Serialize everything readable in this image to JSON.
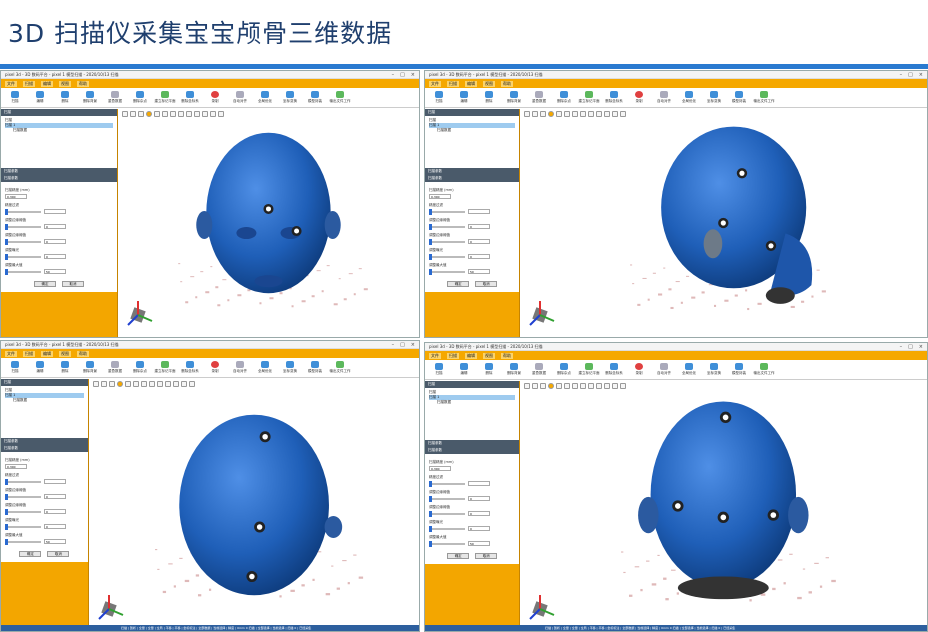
{
  "slide": {
    "title": "3D 扫描仪采集宝宝颅骨三维数据"
  },
  "app": {
    "window_title": "pixel 3d - 3D 数码平台 - pixel 1 模型扫描 - 2020/10/13 扫描",
    "menu": [
      "文件",
      "扫描",
      "编辑",
      "视图",
      "帮助"
    ],
    "ribbon": [
      {
        "label": "扫描",
        "icon": "scan-icon"
      },
      {
        "label": "编辑",
        "icon": "edit-icon"
      },
      {
        "label": "删除",
        "icon": "delete-icon"
      },
      {
        "label": "删除背景",
        "icon": "remove-bg-icon"
      },
      {
        "label": "重叠数据",
        "icon": "overlap-icon"
      },
      {
        "label": "删除杂点",
        "icon": "noise-icon"
      },
      {
        "label": "建立标记平面",
        "icon": "plane-icon"
      },
      {
        "label": "删除坐标系",
        "icon": "axis-icon"
      },
      {
        "label": "录制",
        "icon": "record-icon"
      },
      {
        "label": "自动对齐",
        "icon": "align-icon"
      },
      {
        "label": "全局优化",
        "icon": "optimize-icon"
      },
      {
        "label": "坐标变换",
        "icon": "transform-icon"
      },
      {
        "label": "模型封装",
        "icon": "mesh-icon"
      },
      {
        "label": "输出文件工作",
        "icon": "export-icon"
      }
    ],
    "tree_header": "扫描",
    "tree": [
      "扫描",
      "扫描 1",
      "扫描数据"
    ],
    "params_header": "扫描参数",
    "params_header2": "扫描参数",
    "params": [
      {
        "label": "扫描精度 (mm)",
        "value": "0.300"
      },
      {
        "label": "精度过滤",
        "value": ""
      },
      {
        "label": "调整边缘阈值",
        "value": "0"
      },
      {
        "label": "调整边缘阈值",
        "value": "0"
      },
      {
        "label": "调整曝光",
        "value": "0"
      },
      {
        "label": "调整最大值",
        "value": "50"
      }
    ],
    "buttons": {
      "ok": "确定",
      "cancel": "取消"
    },
    "status_text": "扫描 | 剖析 | 全量 | 全量 | 全局 | 平移 | 平移 | 坐标标注 | 全部数据  | 当前选择 | 精度 | 0mm 0 扫描 | 全部选择 | 当前选择 | 扫描 0 | 已经采集"
  },
  "colors": {
    "accent": "#f5a800",
    "title_rule": "#2a7ad0",
    "title_text": "#1f3f6e",
    "model": "#1f5fb8",
    "status_bar": "#2d5f9e"
  },
  "panels": [
    {
      "id": "front-view",
      "view": "front"
    },
    {
      "id": "side-view",
      "view": "side"
    },
    {
      "id": "top-view",
      "view": "top"
    },
    {
      "id": "back-view",
      "view": "back"
    }
  ]
}
